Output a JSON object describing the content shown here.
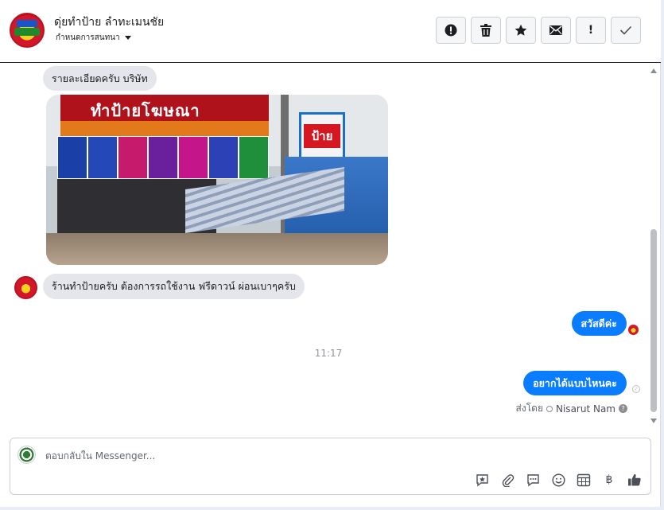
{
  "header": {
    "page_name": "ดุ่ยทำป้าย ลำทะเมนชัย",
    "assign_label": "กำหนดการสนทนา",
    "actions": [
      {
        "icon": "alert-circle-icon",
        "glyph": "!"
      },
      {
        "icon": "trash-icon"
      },
      {
        "icon": "star-icon",
        "glyph": "★"
      },
      {
        "icon": "envelope-icon"
      },
      {
        "icon": "exclamation-icon",
        "glyph": "!"
      },
      {
        "icon": "checkmark-icon",
        "glyph": "✓"
      }
    ]
  },
  "thread": {
    "messages": {
      "m1": {
        "text": "รายละเอียดครับ บริษัท",
        "direction": "incoming"
      },
      "photo": {
        "sign_title": "ทำป้ายโฆษณา",
        "right_sign": "ป้าย"
      },
      "m2": {
        "text": "ร้านทำป้ายครับ ต้องการรถใช้งาน ฟรีดาวน์ ผ่อนเบาๆครับ",
        "direction": "incoming"
      },
      "m3": {
        "text": "สวัสดีค่ะ",
        "direction": "outgoing"
      },
      "m4": {
        "text": "อยากได้แบบไหนคะ",
        "direction": "outgoing"
      }
    },
    "timestamp": "11:17",
    "sent_by": {
      "prefix": "ส่งโดย",
      "agent": "Nisarut Nam",
      "help": "?"
    }
  },
  "composer": {
    "placeholder": "ตอบกลับใน Messenger...",
    "tools": [
      "saved-reply-icon",
      "attachment-icon",
      "chat-bubble-icon",
      "emoji-icon",
      "calendar-icon",
      "baht-icon",
      "thumbs-up-icon"
    ],
    "baht": "฿"
  },
  "colors": {
    "outgoing_bubble": "#0a7cff",
    "incoming_bubble": "#e4e6eb",
    "brand_red": "#d4162a"
  }
}
